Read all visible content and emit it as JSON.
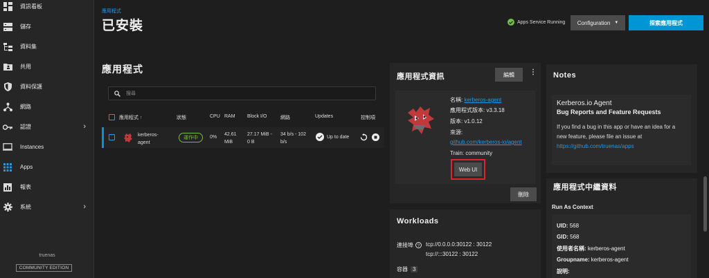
{
  "sidebar": {
    "items": [
      {
        "label": "資訊看板",
        "icon": "dashboard-icon"
      },
      {
        "label": "儲存",
        "icon": "storage-icon"
      },
      {
        "label": "資料集",
        "icon": "datasets-icon"
      },
      {
        "label": "共用",
        "icon": "shares-icon"
      },
      {
        "label": "資料保護",
        "icon": "shield-icon"
      },
      {
        "label": "網路",
        "icon": "network-icon"
      },
      {
        "label": "認證",
        "icon": "key-icon"
      },
      {
        "label": "Instances",
        "icon": "monitor-icon"
      },
      {
        "label": "Apps",
        "icon": "apps-grid-icon"
      },
      {
        "label": "報表",
        "icon": "reports-icon"
      },
      {
        "label": "系統",
        "icon": "gear-icon"
      }
    ],
    "footer_host": "truenas",
    "edition": "COMMUNITY EDITION"
  },
  "header": {
    "breadcrumb": "應用程式",
    "title": "已安裝",
    "service_status": "Apps Service Running",
    "configuration_label": "Configuration",
    "discover_label": "探索應用程式"
  },
  "apps": {
    "heading": "應用程式",
    "search_placeholder": "搜尋",
    "columns": {
      "name": "應用程式",
      "status": "狀態",
      "cpu": "CPU",
      "ram": "RAM",
      "block_io": "Block I/O",
      "network": "網路",
      "updates": "Updates",
      "controls": "控制項"
    },
    "row": {
      "name_line1": "kerberos-",
      "name_line2": "agent",
      "status": "運作中",
      "cpu": "0%",
      "ram_line1": "42.61",
      "ram_line2": "MiB",
      "block_io_line1": "27.17 MiB -",
      "block_io_line2": "0 B",
      "network_line1": "34 b/s - 102",
      "network_line2": "b/s",
      "updates": "Up to date"
    }
  },
  "info": {
    "title": "應用程式資訊",
    "edit_label": "編輯",
    "name_label": "名稱:",
    "name_value": "kerberos-agent",
    "app_version_label": "應用程式版本:",
    "app_version_value": "v3.3.18",
    "version_label": "版本:",
    "version_value": "v1.0.12",
    "source_label": "來源:",
    "source_value": "github.com/kerberos-io/agent",
    "train_label": "Train:",
    "train_value": "community",
    "web_ui_label": "Web UI",
    "delete_label": "刪除"
  },
  "workloads": {
    "title": "Workloads",
    "ports_label": "連接埠",
    "port1": "tcp://0.0.0.0:30122 : 30122",
    "port2": "tcp://:::30122 : 30122",
    "containers_label": "容器",
    "containers_count": "3"
  },
  "notes": {
    "title": "Notes",
    "heading": "Kerberos.io Agent",
    "subheading": "Bug Reports and Feature Requests",
    "body_line1": "If you find a bug in this app or have an idea for a",
    "body_line2": "new feature, please file an issue at",
    "link": "https://github.com/truenas/apps"
  },
  "metadata": {
    "title": "應用程式中繼資料",
    "run_as_context": "Run As Context",
    "uid_label": "UID:",
    "uid_value": "568",
    "gid_label": "GID:",
    "gid_value": "568",
    "user_label": "使用者名稱:",
    "user_value": "kerberos-agent",
    "group_label": "Groupname:",
    "group_value": "kerberos-agent",
    "desc_label": "說明:"
  },
  "colors": {
    "accent": "#0095d5",
    "running": "#71bf44",
    "highlight": "#e0232e"
  }
}
